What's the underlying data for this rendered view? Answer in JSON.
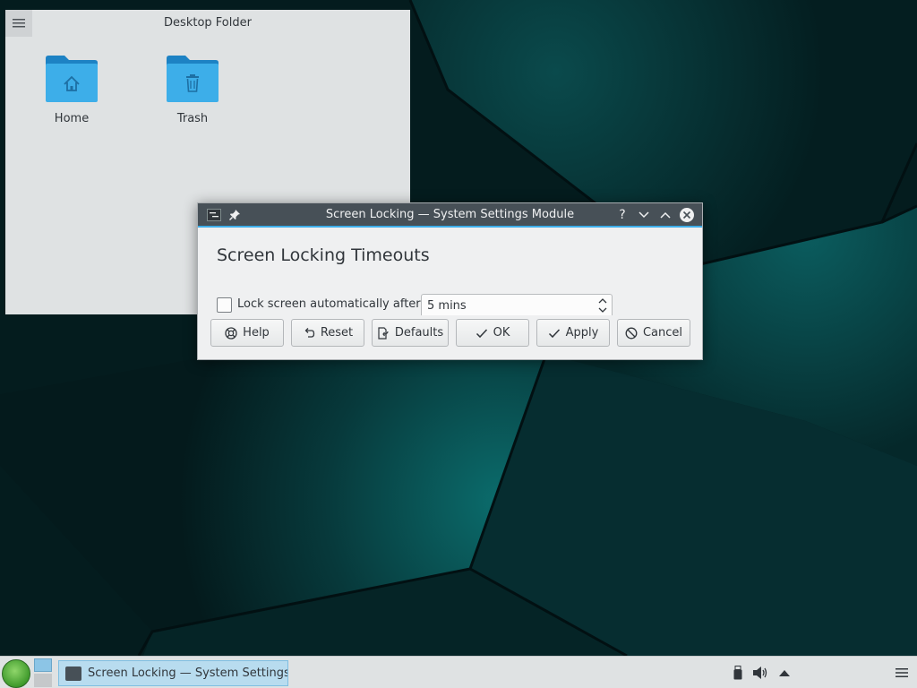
{
  "desktop": {
    "folder_widget": {
      "title": "Desktop Folder",
      "items": [
        {
          "label": "Home",
          "icon": "folder-home-icon"
        },
        {
          "label": "Trash",
          "icon": "trash-folder-icon"
        }
      ]
    }
  },
  "dialog": {
    "title": "Screen Locking — System Settings Module",
    "heading": "Screen Locking Timeouts",
    "lock_checkbox": {
      "label": "Lock screen automatically after:",
      "checked": false
    },
    "timeout_spinbox": {
      "value": "5 mins"
    },
    "buttons": {
      "help": "Help",
      "reset": "Reset",
      "defaults": "Defaults",
      "ok": "OK",
      "apply": "Apply",
      "cancel": "Cancel"
    },
    "titlebar_help": "?"
  },
  "taskbar": {
    "tasks": [
      {
        "label": "Screen Locking — System Settings Module"
      }
    ],
    "tray_icons": [
      "usb-device-icon",
      "volume-icon",
      "expand-tray-icon",
      "hamburger-menu-icon"
    ]
  },
  "colors": {
    "accent": "#3daee9",
    "titlebar": "#475057",
    "window_bg": "#eff0f1",
    "panel_bg": "#dfe2e3",
    "wallpaper": "#062a2c"
  }
}
